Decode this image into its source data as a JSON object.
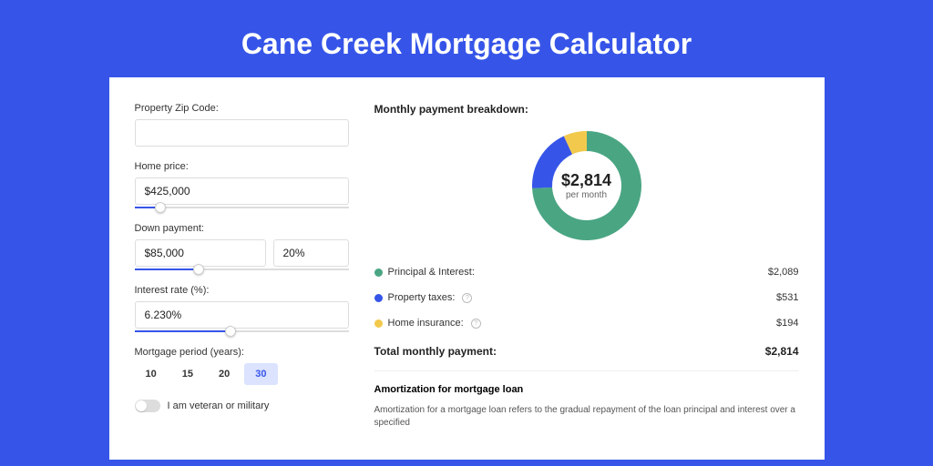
{
  "page_title": "Cane Creek Mortgage Calculator",
  "colors": {
    "principal": "#4aa583",
    "taxes": "#3655e8",
    "insurance": "#f2c94c"
  },
  "form": {
    "zip_label": "Property Zip Code:",
    "zip_value": "",
    "home_price_label": "Home price:",
    "home_price_value": "$425,000",
    "home_price_slider_fill_pct": 12,
    "down_payment_label": "Down payment:",
    "down_payment_value": "$85,000",
    "down_payment_pct": "20%",
    "down_payment_slider_fill_pct": 30,
    "interest_label": "Interest rate (%):",
    "interest_value": "6.230%",
    "interest_slider_fill_pct": 45,
    "period_label": "Mortgage period (years):",
    "periods": [
      "10",
      "15",
      "20",
      "30"
    ],
    "period_active": "30",
    "veteran_label": "I am veteran or military"
  },
  "breakdown": {
    "heading": "Monthly payment breakdown:",
    "center_amount": "$2,814",
    "center_sub": "per month",
    "items": [
      {
        "label": "Principal & Interest:",
        "value": "$2,089",
        "color_key": "principal",
        "info": false
      },
      {
        "label": "Property taxes:",
        "value": "$531",
        "color_key": "taxes",
        "info": true
      },
      {
        "label": "Home insurance:",
        "value": "$194",
        "color_key": "insurance",
        "info": true
      }
    ],
    "total_label": "Total monthly payment:",
    "total_value": "$2,814"
  },
  "chart_data": {
    "type": "pie",
    "title": "Monthly payment breakdown",
    "categories": [
      "Principal & Interest",
      "Property taxes",
      "Home insurance"
    ],
    "values": [
      2089,
      531,
      194
    ],
    "colors": [
      "#4aa583",
      "#3655e8",
      "#f2c94c"
    ]
  },
  "amort": {
    "title": "Amortization for mortgage loan",
    "text": "Amortization for a mortgage loan refers to the gradual repayment of the loan principal and interest over a specified"
  }
}
